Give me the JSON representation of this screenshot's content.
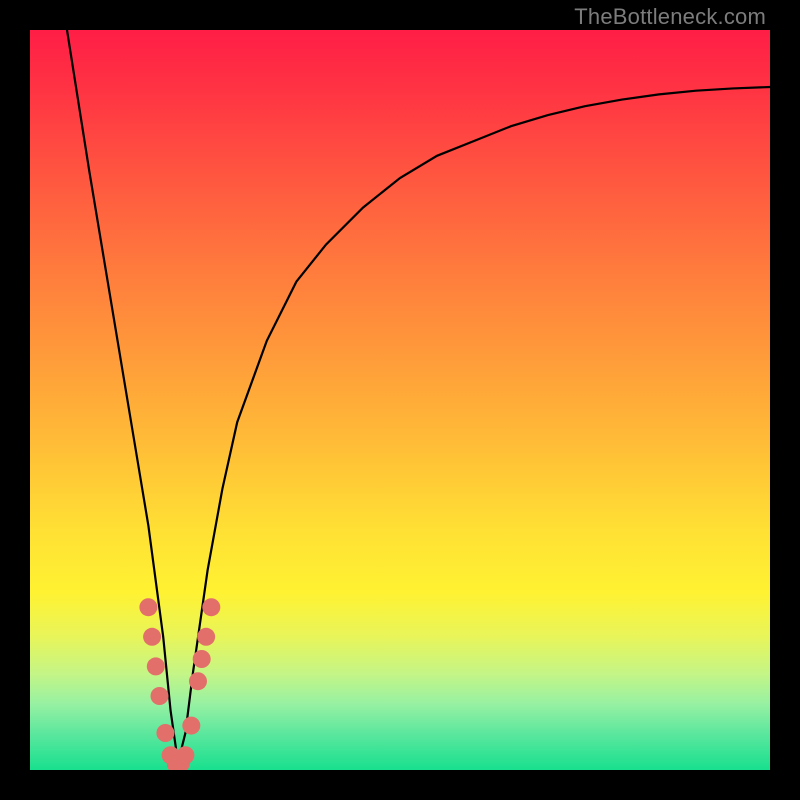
{
  "watermark": "TheBottleneck.com",
  "chart_data": {
    "type": "line",
    "title": "",
    "xlabel": "",
    "ylabel": "",
    "xlim": [
      0,
      100
    ],
    "ylim": [
      0,
      100
    ],
    "grid": false,
    "legend": false,
    "series": [
      {
        "name": "bottleneck-curve",
        "x": [
          5,
          8,
          10,
          12,
          14,
          16,
          18,
          19,
          20,
          21,
          22,
          24,
          26,
          28,
          32,
          36,
          40,
          45,
          50,
          55,
          60,
          65,
          70,
          75,
          80,
          85,
          90,
          95,
          100
        ],
        "y": [
          100,
          81,
          69,
          57,
          45,
          33,
          18,
          8,
          1,
          5,
          13,
          27,
          38,
          47,
          58,
          66,
          71,
          76,
          80,
          83,
          85,
          87,
          88.5,
          89.7,
          90.6,
          91.3,
          91.8,
          92.1,
          92.3
        ]
      }
    ],
    "markers": {
      "name": "highlight-dots",
      "color": "#e26f6a",
      "radius_px": 9,
      "points": [
        {
          "x": 16.0,
          "y": 22
        },
        {
          "x": 16.5,
          "y": 18
        },
        {
          "x": 17.0,
          "y": 14
        },
        {
          "x": 17.5,
          "y": 10
        },
        {
          "x": 18.3,
          "y": 5
        },
        {
          "x": 19.0,
          "y": 2
        },
        {
          "x": 19.7,
          "y": 0.8
        },
        {
          "x": 20.4,
          "y": 0.9
        },
        {
          "x": 21.0,
          "y": 2
        },
        {
          "x": 21.8,
          "y": 6
        },
        {
          "x": 22.7,
          "y": 12
        },
        {
          "x": 23.2,
          "y": 15
        },
        {
          "x": 23.8,
          "y": 18
        },
        {
          "x": 24.5,
          "y": 22
        }
      ]
    }
  }
}
